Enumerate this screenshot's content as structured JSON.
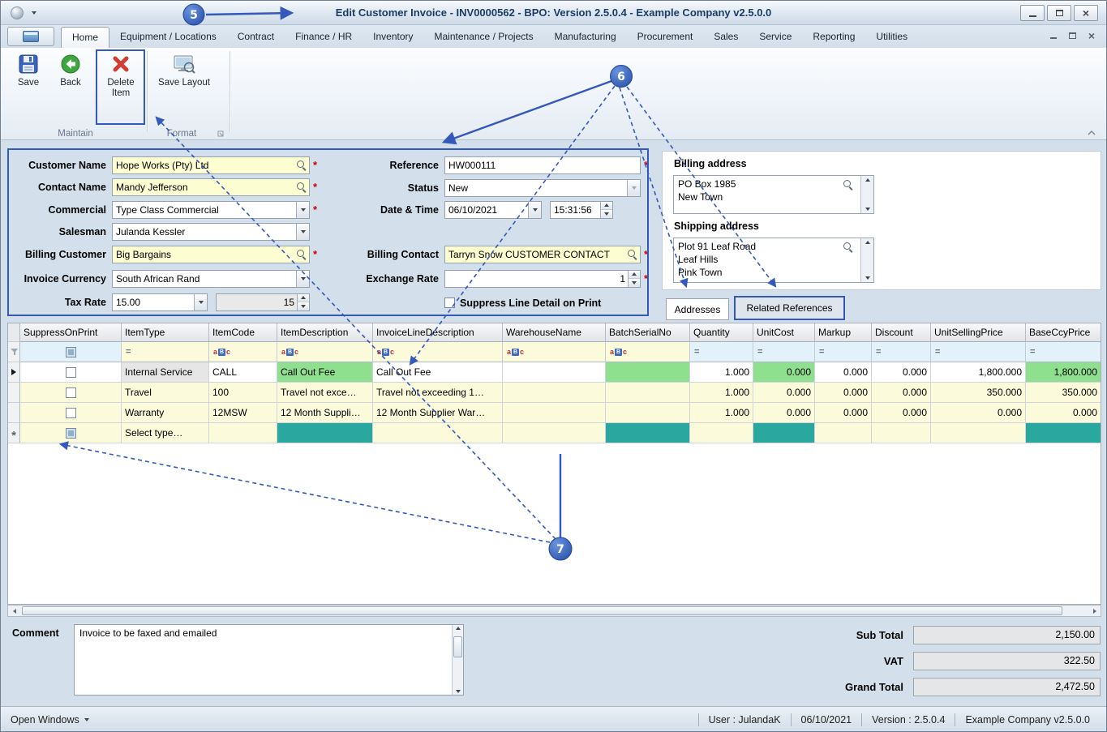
{
  "titlebar": {
    "title": "Edit Customer Invoice - INV0000562 - BPO: Version 2.5.0.4 - Example Company v2.5.0.0"
  },
  "ribbon": {
    "tabs": [
      "Home",
      "Equipment / Locations",
      "Contract",
      "Finance / HR",
      "Inventory",
      "Maintenance / Projects",
      "Manufacturing",
      "Procurement",
      "Sales",
      "Service",
      "Reporting",
      "Utilities"
    ],
    "buttons": {
      "save": "Save",
      "back": "Back",
      "delete_item": "Delete Item",
      "save_layout": "Save Layout"
    },
    "groups": {
      "maintain": "Maintain",
      "format": "Format"
    }
  },
  "form": {
    "required_marker": "*",
    "customer_name": {
      "label": "Customer Name",
      "value": "Hope Works (Pty) Ltd"
    },
    "contact_name": {
      "label": "Contact Name",
      "value": "Mandy Jefferson"
    },
    "commercial": {
      "label": "Commercial",
      "value": "Type Class Commercial"
    },
    "salesman": {
      "label": "Salesman",
      "value": "Julanda Kessler"
    },
    "billing_customer": {
      "label": "Billing Customer",
      "value": "Big Bargains"
    },
    "invoice_currency": {
      "label": "Invoice Currency",
      "value": "South African Rand"
    },
    "tax_rate": {
      "label": "Tax Rate",
      "value": "15.00",
      "amount": "15"
    },
    "reference": {
      "label": "Reference",
      "value": "HW000111"
    },
    "status": {
      "label": "Status",
      "value": "New"
    },
    "date_time": {
      "label": "Date & Time",
      "date": "06/10/2021",
      "time": "15:31:56"
    },
    "billing_contact": {
      "label": "Billing Contact",
      "value": "Tarryn Snow CUSTOMER CONTACT"
    },
    "exchange_rate": {
      "label": "Exchange Rate",
      "value": "1"
    },
    "suppress_print": {
      "label": "Suppress Line Detail on Print"
    }
  },
  "addresses": {
    "billing_label": "Billing address",
    "billing_lines": [
      "PO Box 1985",
      "New Town"
    ],
    "shipping_label": "Shipping address",
    "shipping_lines": [
      "Plot 91 Leaf Road",
      "Leaf Hills",
      "Pink Town"
    ],
    "tab_addresses": "Addresses",
    "tab_related": "Related References"
  },
  "grid": {
    "columns": [
      "SuppressOnPrint",
      "ItemType",
      "ItemCode",
      "ItemDescription",
      "InvoiceLineDescription",
      "WarehouseName",
      "BatchSerialNo",
      "Quantity",
      "UnitCost",
      "Markup",
      "Discount",
      "UnitSellingPrice",
      "BaseCcyPrice"
    ],
    "rows": [
      {
        "cells": [
          "Internal Service",
          "CALL",
          "Call Out Fee",
          "Call Out Fee",
          "",
          "",
          "1.000",
          "0.000",
          "0.000",
          "0.000",
          "1,800.000",
          "1,800.000"
        ]
      },
      {
        "cells": [
          "Travel",
          "100",
          "Travel not exce…",
          "Travel not exceeding 1…",
          "",
          "",
          "1.000",
          "0.000",
          "0.000",
          "0.000",
          "350.000",
          "350.000"
        ]
      },
      {
        "cells": [
          "Warranty",
          "12MSW",
          "12 Month Suppli…",
          "12 Month Supplier War…",
          "",
          "",
          "1.000",
          "0.000",
          "0.000",
          "0.000",
          "0.000",
          "0.000"
        ]
      },
      {
        "cells": [
          "Select type…",
          "",
          "",
          "",
          "",
          "",
          "",
          "",
          "",
          "",
          "",
          ""
        ]
      }
    ]
  },
  "footer": {
    "comment_label": "Comment",
    "comment_value": "Invoice to be faxed and emailed",
    "subtotal_label": "Sub Total",
    "subtotal_value": "2,150.00",
    "vat_label": "VAT",
    "vat_value": "322.50",
    "grandtotal_label": "Grand Total",
    "grandtotal_value": "2,472.50"
  },
  "statusbar": {
    "open_windows": "Open Windows",
    "user": "User : JulandaK",
    "date": "06/10/2021",
    "version": "Version : 2.5.0.4",
    "company": "Example Company v2.5.0.0"
  },
  "annotations": {
    "c5": "5",
    "c6": "6",
    "c7": "7"
  },
  "colors": {
    "annotation_blue": "#3558bc",
    "field_yellow": "#fdfdd2",
    "cell_green": "#8ee08e",
    "cell_teal": "#2aa8a0",
    "required_red": "#cc0000"
  }
}
